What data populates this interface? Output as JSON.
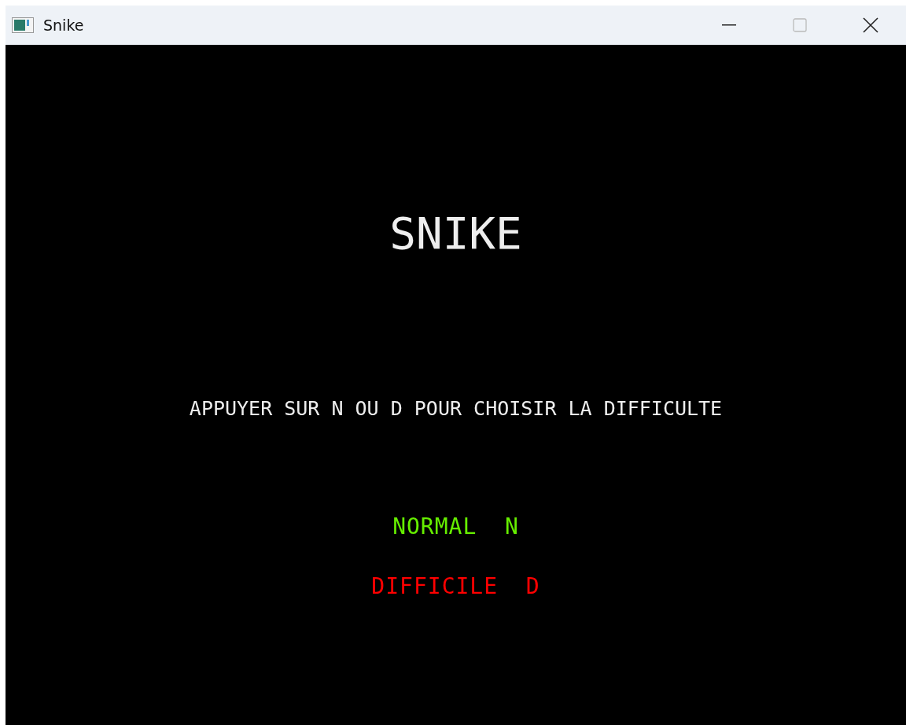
{
  "window": {
    "title": "Snike"
  },
  "game": {
    "title": "SNIKE",
    "instruction": "APPUYER SUR N OU D POUR CHOISIR LA DIFFICULTE",
    "options": [
      {
        "label": "NORMAL  N",
        "color": "#66ee00"
      },
      {
        "label": "DIFFICILE  D",
        "color": "#ff0000"
      }
    ]
  }
}
